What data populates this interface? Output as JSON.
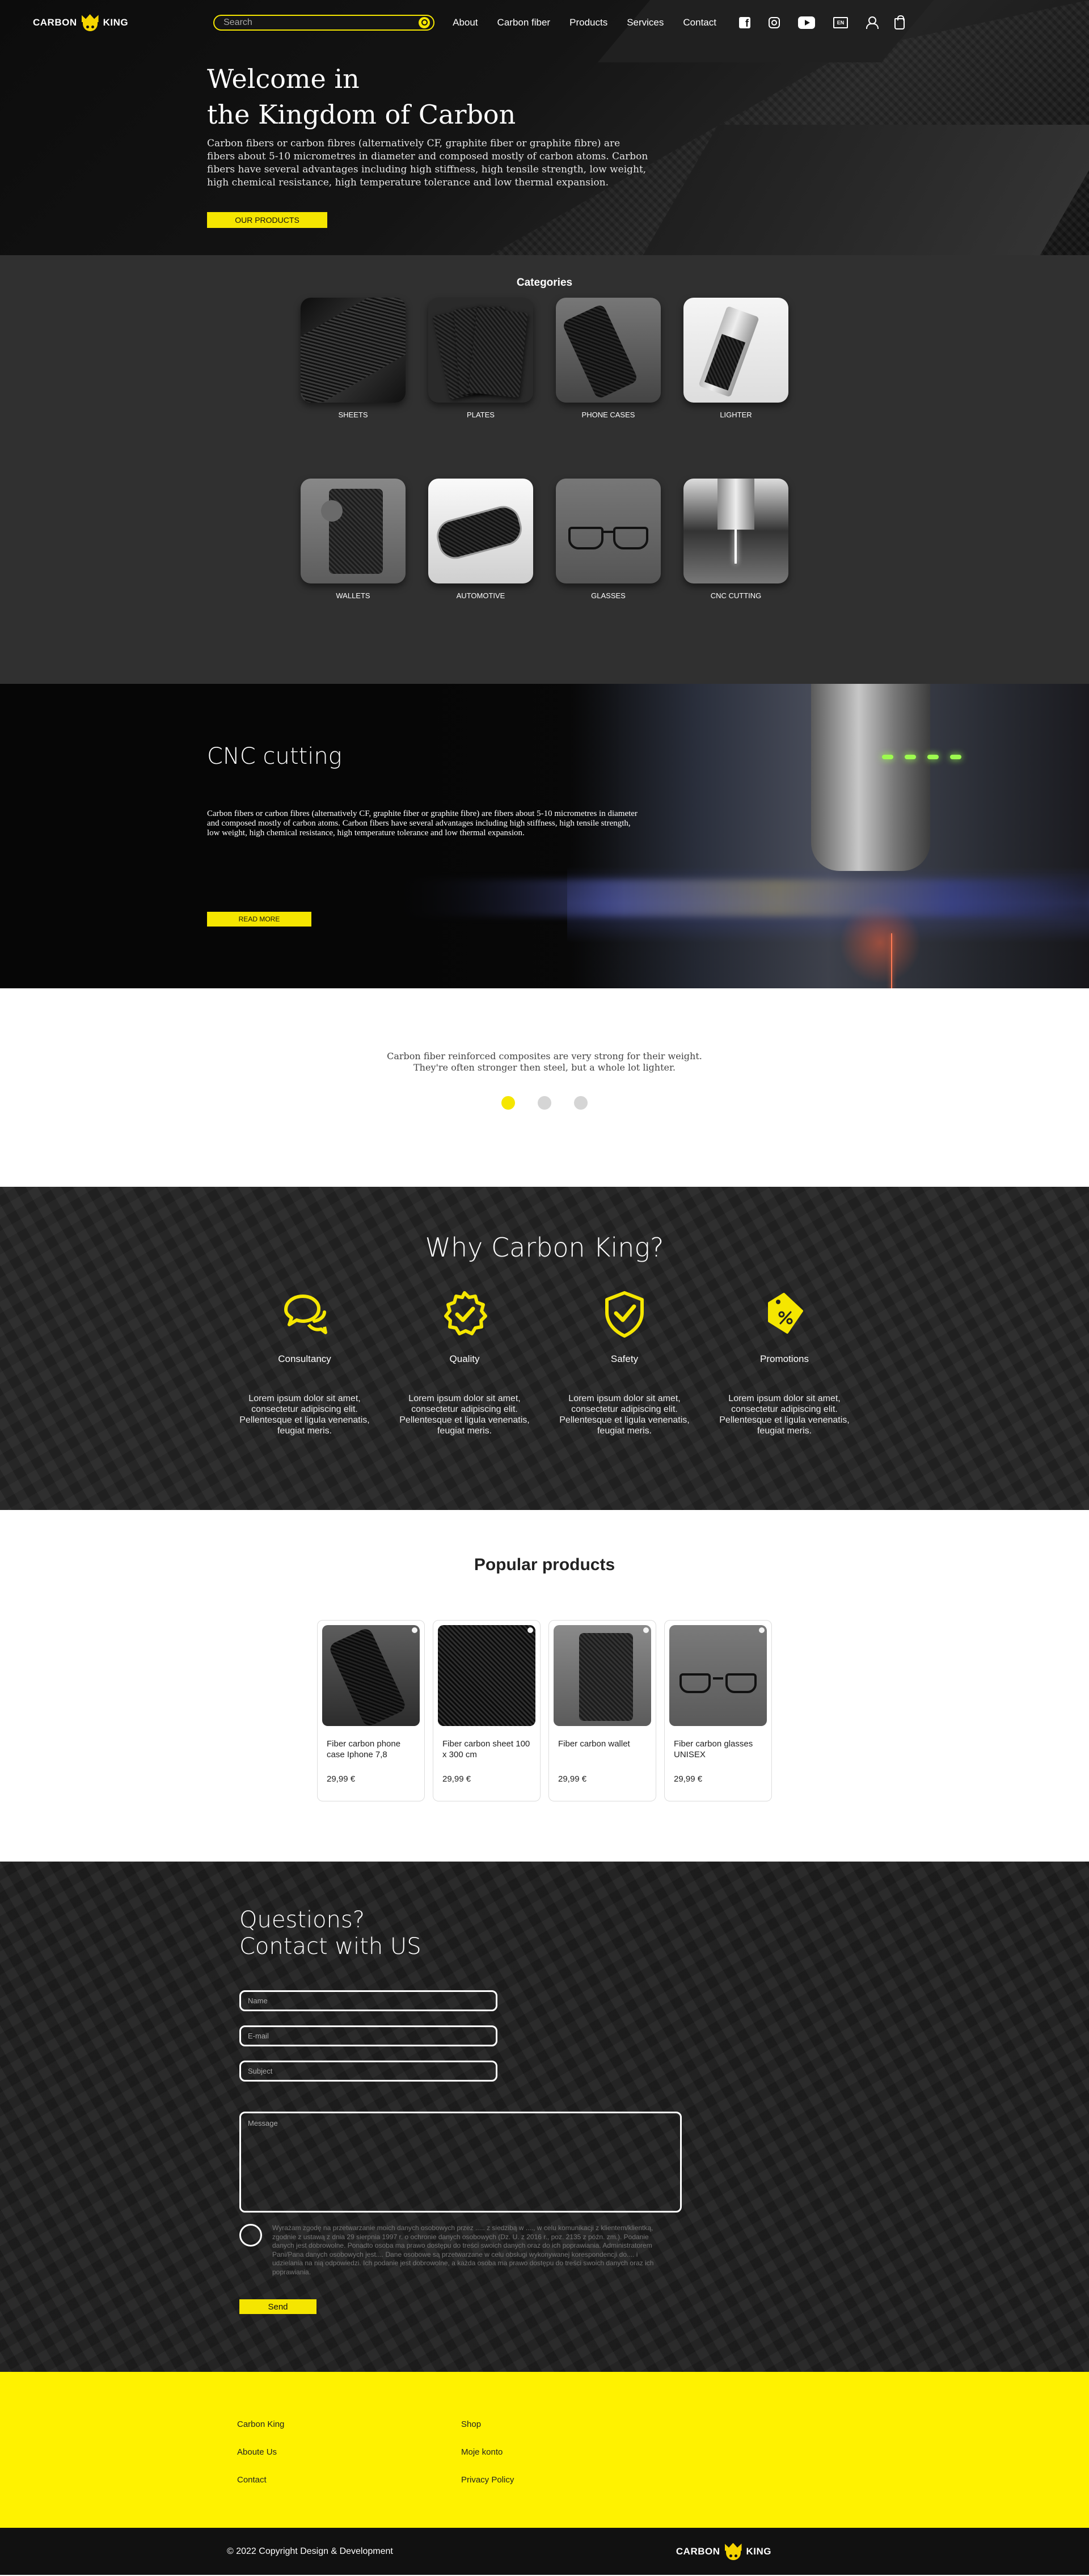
{
  "brand": {
    "name_left": "CARBON",
    "name_right": "KING"
  },
  "search": {
    "placeholder": "Search"
  },
  "nav": {
    "items": [
      "About",
      "Carbon fiber",
      "Products",
      "Services",
      "Contact"
    ],
    "lang": "EN"
  },
  "hero": {
    "title_line1": "Welcome in",
    "title_line2": "the Kingdom of Carbon",
    "text": "Carbon fibers or carbon fibres (alternatively CF, graphite fiber or graphite fibre) are fibers about 5-10 micrometres in diameter and composed mostly of carbon atoms. Carbon fibers have several advantages including high stiffness, high tensile strength, low weight, high chemical resistance, high temperature tolerance and low thermal expansion.",
    "button": "OUR PRODUCTS"
  },
  "categories": {
    "title": "Categories",
    "items": [
      "SHEETS",
      "PLATES",
      "PHONE CASES",
      "LIGHTER",
      "WALLETS",
      "AUTOMOTIVE",
      "GLASSES",
      "CNC CUTTING"
    ]
  },
  "cnc": {
    "title": "CNC cutting",
    "text": "Carbon fibers or carbon fibres (alternatively CF, graphite fiber or graphite fibre) are fibers about 5-10 micrometres in diameter and composed mostly of carbon atoms. Carbon fibers have several advantages including high stiffness, high tensile strength, low weight, high chemical resistance, high temperature tolerance and low thermal expansion.",
    "button": "READ MORE"
  },
  "quote": {
    "line1": "Carbon fiber reinforced composites are very strong for their weight.",
    "line2": "They're often stronger then steel, but a whole lot lighter."
  },
  "why": {
    "title": "Why Carbon King?",
    "items": [
      {
        "icon": "chat-bubbles-icon",
        "title": "Consultancy",
        "text": "Lorem ipsum dolor sit amet, consectetur adipiscing elit. Pellentesque et ligula venenatis, feugiat meris."
      },
      {
        "icon": "badge-check-icon",
        "title": "Quality",
        "text": "Lorem ipsum dolor sit amet, consectetur adipiscing elit. Pellentesque et ligula venenatis, feugiat meris."
      },
      {
        "icon": "shield-check-icon",
        "title": "Safety",
        "text": "Lorem ipsum dolor sit amet, consectetur adipiscing elit. Pellentesque et ligula venenatis, feugiat meris."
      },
      {
        "icon": "price-tag-percent-icon",
        "title": "Promotions",
        "text": "Lorem ipsum dolor sit amet, consectetur adipiscing elit. Pellentesque et ligula venenatis, feugiat meris."
      }
    ]
  },
  "popular": {
    "title": "Popular products",
    "items": [
      {
        "name": "Fiber carbon phone case Iphone 7,8",
        "price": "29,99 €"
      },
      {
        "name": "Fiber carbon sheet 100 x 300 cm",
        "price": "29,99 €"
      },
      {
        "name": "Fiber carbon wallet",
        "price": "29,99 €"
      },
      {
        "name": "Fiber carbon glasses UNISEX",
        "price": "29,99 €"
      }
    ]
  },
  "contact": {
    "title_line1": "Questions?",
    "title_line2": "Contact with US",
    "name_placeholder": "Name",
    "email_placeholder": "E-mail",
    "subject_placeholder": "Subject",
    "message_placeholder": "Message",
    "consent": "Wyrażam zgodę na przetwarzanie moich danych osobowych przez ..... z siedzibą w ...., w celu komunikacji z klientem/klientką, zgodnie z ustawą z dnia 29 sierpnia 1997 r. o ochronie danych osobowych (Dz. U. z 2016 r., poz. 2135 z późn. zm.). Podanie danych jest dobrowolne. Ponadto osoba ma prawo dostępu do treści swoich danych oraz do ich poprawiania. Administratorem Pani/Pana danych osobowych jest.... Dane osobowe są przetwarzane w celu obsługi wykonywanej korespondencji do.... i udzielania na nią odpowiedzi. Ich podanie jest dobrowolne, a każda osoba ma prawo dostępu do treści swoich danych oraz ich poprawiania.",
    "button": "Send"
  },
  "footer": {
    "col1": [
      "Carbon King",
      "Aboute Us",
      "Contact"
    ],
    "col2": [
      "Shop",
      "Moje konto",
      "Privacy Policy"
    ],
    "copyright": "© 2022 Copyright Design & Development"
  },
  "colors": {
    "accent": "#f5e600",
    "dark": "#303030",
    "footer": "#fff200"
  }
}
